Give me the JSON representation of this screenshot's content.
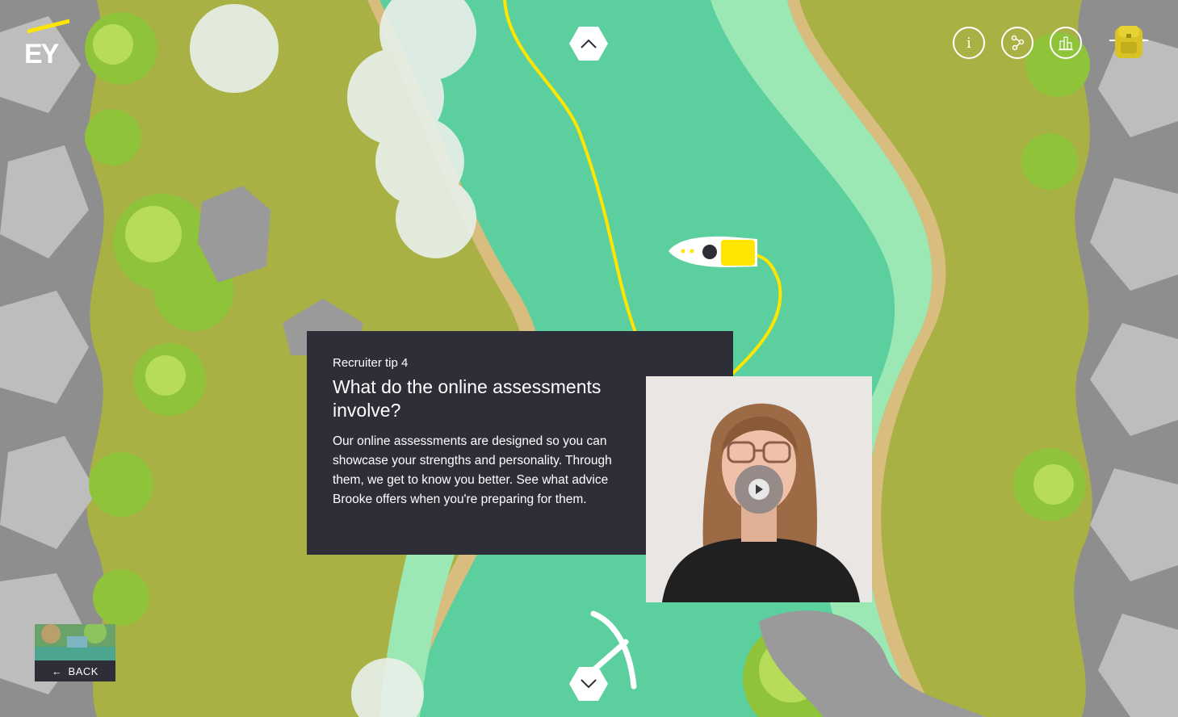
{
  "brand": {
    "logo_text": "EY",
    "accent": "#ffe600"
  },
  "navigation": {
    "up_icon": "chevron-up-icon",
    "down_icon": "chevron-down-icon"
  },
  "toolbar": {
    "info_glyph": "i",
    "info_icon": "info-icon",
    "share_icon": "share-icon",
    "chart_icon": "leaderboard-icon",
    "backpack_icon": "backpack-icon"
  },
  "tip": {
    "label": "Recruiter tip 4",
    "title": "What do the online assessments involve?",
    "body": "Our online assessments are designed so you can showcase your strengths and personality. Through them, we get to know you better. See what advice Brooke offers when you're preparing for them."
  },
  "video": {
    "play_icon": "play-icon"
  },
  "back": {
    "label": "BACK",
    "arrow_icon": "arrow-left-icon"
  },
  "colors": {
    "ground": "#a9b145",
    "river": "#5ccf9f",
    "river_light": "#9be8b5",
    "card": "#2e2e38",
    "path": "#ffe600"
  }
}
